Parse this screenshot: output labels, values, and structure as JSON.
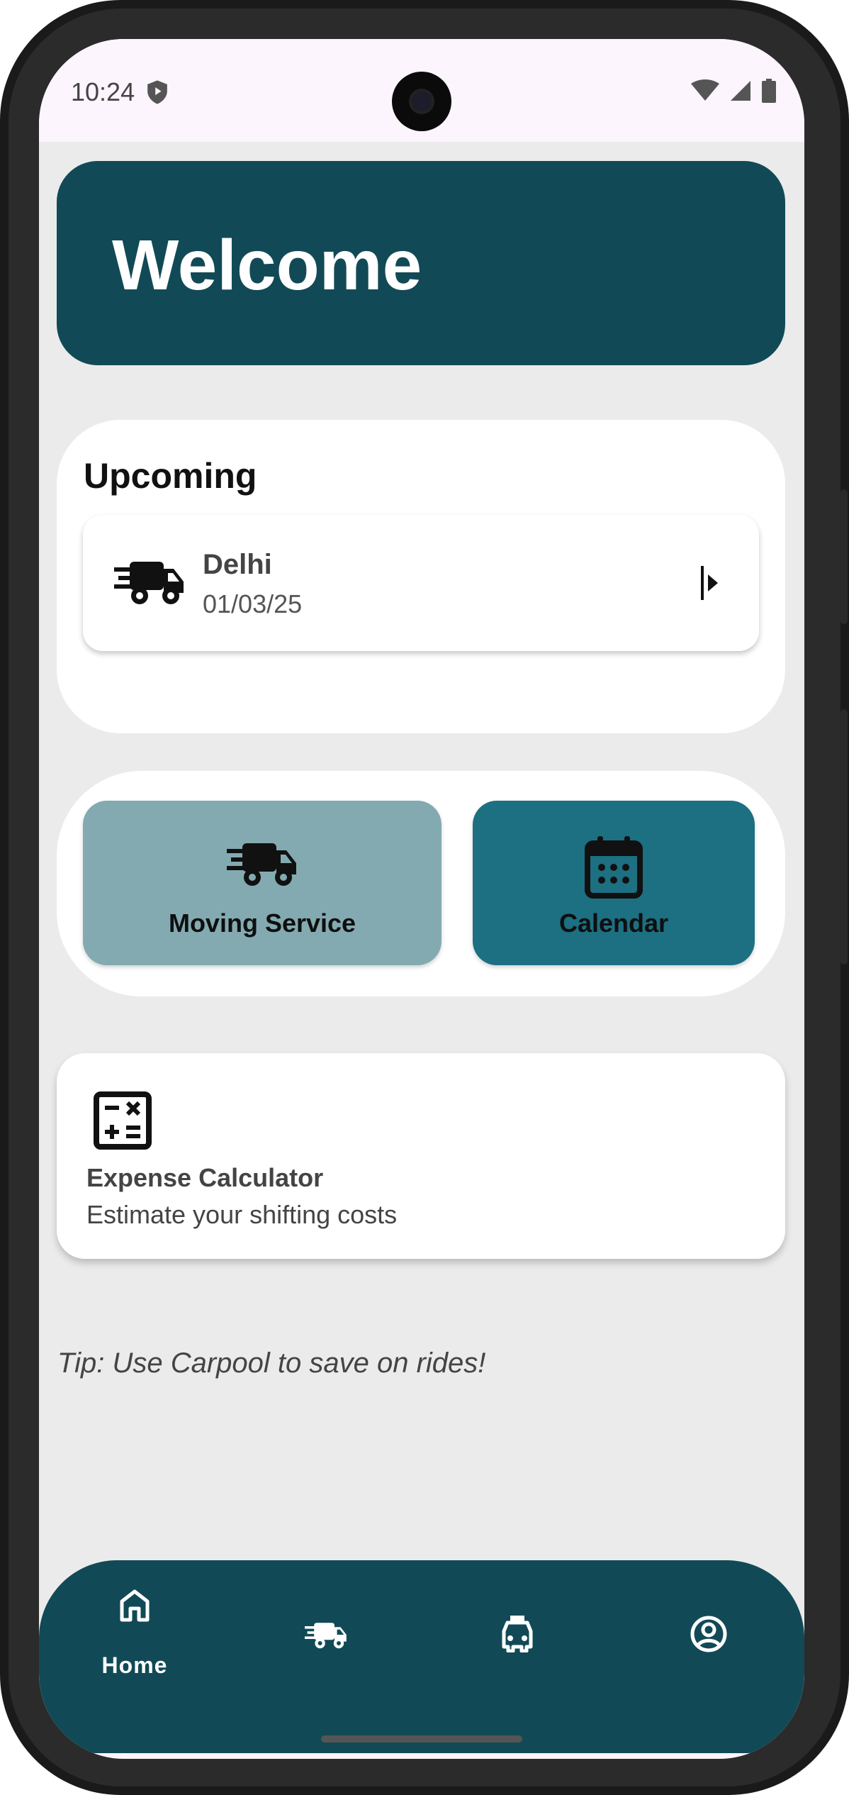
{
  "status_bar": {
    "time": "10:24"
  },
  "header": {
    "title": "Welcome"
  },
  "upcoming": {
    "title": "Upcoming",
    "trip": {
      "city": "Delhi",
      "date": "01/03/25"
    }
  },
  "actions": [
    {
      "label": "Moving Service",
      "icon": "truck-icon",
      "color": "#83aab1"
    },
    {
      "label": "Calendar",
      "icon": "calendar-icon",
      "color": "#1d6f82"
    }
  ],
  "expense": {
    "title": "Expense Calculator",
    "subtitle": "Estimate your shifting costs",
    "icon": "calculator-icon"
  },
  "tip": "Tip: Use Carpool to save on rides!",
  "bottom_nav": {
    "items": [
      {
        "label": "Home",
        "icon": "home-icon",
        "active": true
      },
      {
        "label": "",
        "icon": "truck-icon",
        "active": false
      },
      {
        "label": "",
        "icon": "taxi-icon",
        "active": false
      },
      {
        "label": "",
        "icon": "account-icon",
        "active": false
      }
    ]
  },
  "colors": {
    "primary": "#114a56",
    "background": "#ebebeb",
    "moving": "#83aab1",
    "calendar": "#1d6f82"
  }
}
